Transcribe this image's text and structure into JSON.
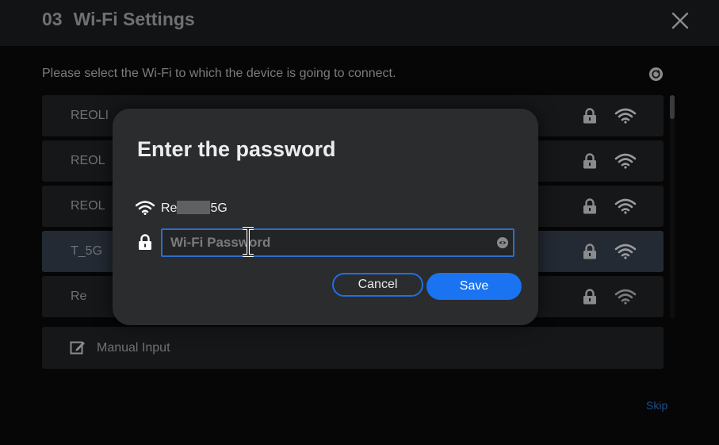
{
  "header": {
    "step_number": "03",
    "title": "Wi-Fi Settings",
    "close_icon": "close-icon"
  },
  "instruction": "Please select the Wi-Fi to which the device is going to connect.",
  "refresh_icon": "refresh-icon",
  "wifi_list": [
    {
      "name": "REOLI",
      "secured": true,
      "signal": "full"
    },
    {
      "name": "REOL",
      "secured": true,
      "signal": "full"
    },
    {
      "name": "REOL",
      "secured": true,
      "signal": "full"
    },
    {
      "name": "T_5G",
      "secured": true,
      "signal": "full",
      "selected": true
    },
    {
      "name": "Re",
      "secured": true,
      "signal": "medium"
    }
  ],
  "manual_input": {
    "label": "Manual Input",
    "icon": "edit-icon"
  },
  "skip_label": "Skip",
  "modal": {
    "title": "Enter the password",
    "ssid_prefix": "Re",
    "ssid_suffix": "5G",
    "password_placeholder": "Wi-Fi Password",
    "password_value": "",
    "cancel_label": "Cancel",
    "save_label": "Save"
  },
  "colors": {
    "accent": "#1a73f0",
    "page_background": "#060606",
    "modal_background": "#2b2c2e",
    "row_background": "#161718"
  }
}
